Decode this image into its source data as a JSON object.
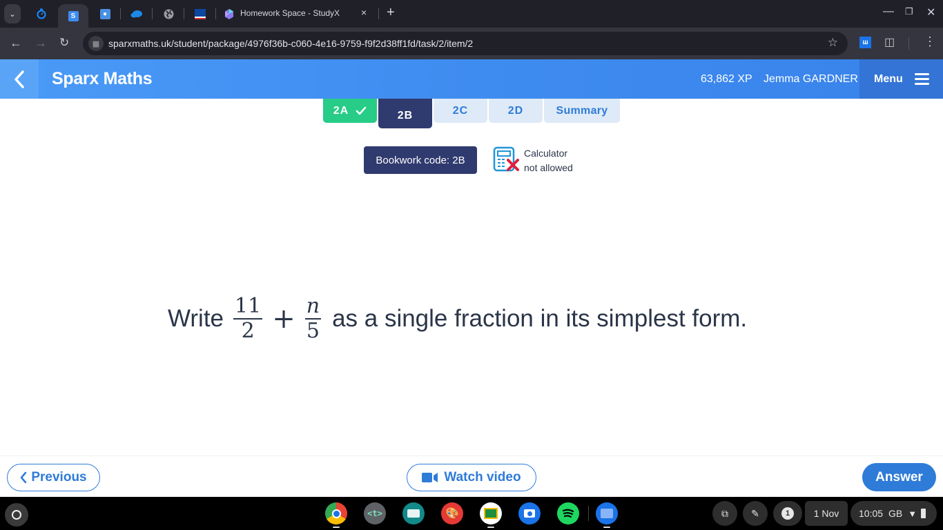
{
  "browser": {
    "tabs": [
      {
        "icon": "dropdown-icon"
      },
      {
        "icon": "timer-icon",
        "color": "#1a73e8"
      },
      {
        "icon": "sparx-s-icon",
        "label": "S",
        "color": "#3f8cf0",
        "active": true
      },
      {
        "icon": "classroom-contact-icon",
        "color": "#4a90e2"
      },
      {
        "icon": "onedrive-cloud-icon",
        "color": "#1e88e5"
      },
      {
        "icon": "globe-icon",
        "color": "#aaaaaa"
      },
      {
        "icon": "flag-icon",
        "color": "#0d47a1"
      },
      {
        "icon": "studyx-gem-icon",
        "title": "Homework Space - StudyX"
      }
    ],
    "new_tab_label": "+",
    "close_tab_label": "×",
    "url": "sparxmaths.uk/student/package/4976f36b-c060-4e16-9759-f9f2d38ff1fd/task/2/item/2"
  },
  "header": {
    "title": "Sparx Maths",
    "xp": "63,862 XP",
    "user_name": "Jemma GARDNER",
    "menu_label": "Menu"
  },
  "task_tabs": [
    {
      "label": "2A",
      "state": "complete"
    },
    {
      "label": "2B",
      "state": "current"
    },
    {
      "label": "2C",
      "state": "todo"
    },
    {
      "label": "2D",
      "state": "todo"
    },
    {
      "label": "Summary",
      "state": "todo"
    }
  ],
  "bookwork": {
    "label": "Bookwork code: 2B"
  },
  "calculator": {
    "line1": "Calculator",
    "line2": "not allowed"
  },
  "question": {
    "prefix": "Write",
    "fraction1": {
      "numerator": "11",
      "denominator": "2"
    },
    "operator": "+",
    "fraction2": {
      "numerator": "n",
      "denominator": "5"
    },
    "suffix": "as a single fraction in its simplest form."
  },
  "footer": {
    "previous_label": "Previous",
    "watch_video_label": "Watch video",
    "answer_label": "Answer"
  },
  "shelf": {
    "apps": [
      "chrome",
      "text-editor",
      "screencast",
      "canvas",
      "google-classroom",
      "camera",
      "spotify",
      "files"
    ],
    "notification_count": "1",
    "date": "1 Nov",
    "time": "10:05",
    "locale": "GB"
  },
  "colors": {
    "brand_blue": "#3f8cf0",
    "complete_green": "#27cc87",
    "current_navy": "#2f3a6e",
    "todo_bg": "#deeaf7",
    "action_blue": "#2e7bd8",
    "text_dark": "#2b3548"
  }
}
